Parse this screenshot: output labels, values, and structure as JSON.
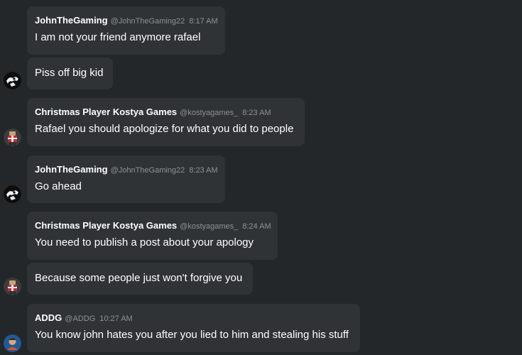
{
  "colors": {
    "background": "#24272a",
    "bubble": "#303336",
    "meta_text": "#8d9196",
    "message_text": "#ffffff"
  },
  "messages": [
    {
      "author": "JohnTheGaming",
      "handle": "@JohnTheGaming22",
      "time": "8:17 AM",
      "text": "I am not your friend anymore rafael"
    },
    {
      "text": "Piss off big kid",
      "avatar_icon": "johnthegaming-avatar-icon"
    },
    {
      "author": "Christmas Player Kostya Games",
      "handle": "@kostyagames_",
      "time": "8:23 AM",
      "text": "Rafael you should apologize for what you did to people",
      "avatar_icon": "kostya-avatar-icon"
    },
    {
      "author": "JohnTheGaming",
      "handle": "@JohnTheGaming22",
      "time": "8:23 AM",
      "text": "Go ahead",
      "avatar_icon": "johnthegaming-avatar-icon"
    },
    {
      "author": "Christmas Player Kostya Games",
      "handle": "@kostyagames_",
      "time": "8:24 AM",
      "text": "You need to publish a post about your apology"
    },
    {
      "text": "Because some people just won't forgive you",
      "avatar_icon": "kostya-avatar-icon"
    },
    {
      "author": "ADDG",
      "handle": "@ADDG",
      "time": "10:27 AM",
      "text": "You know john hates you after you lied to him and stealing his stuff",
      "avatar_icon": "addg-avatar-icon"
    }
  ]
}
